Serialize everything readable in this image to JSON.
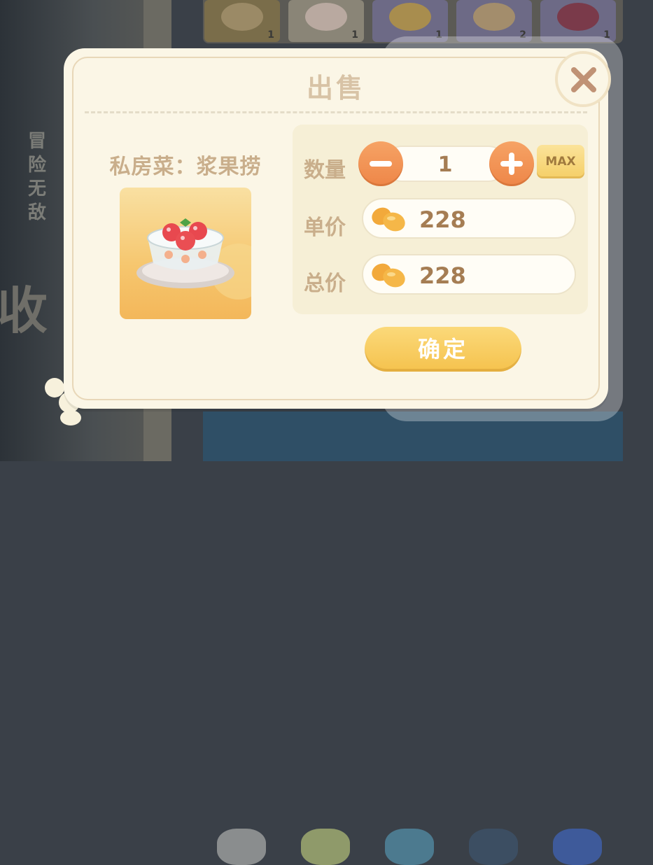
{
  "background": {
    "side_text": "冒险无敌",
    "big_glyph": "收",
    "top_counts": [
      "1",
      "1",
      "1",
      "2",
      "1"
    ]
  },
  "dialog": {
    "title": "出售",
    "item_name": "私房菜：浆果捞",
    "item_icon": "berry-dessert-bowl",
    "quantity_label": "数量",
    "quantity_value": "1",
    "minus_icon": "minus-icon",
    "plus_icon": "plus-icon",
    "max_label": "MAX",
    "unit_price_label": "单价",
    "unit_price_value": "228",
    "total_price_label": "总价",
    "total_price_value": "228",
    "currency_icon": "bean-coin-icon",
    "confirm_label": "确定",
    "close_icon": "close-icon"
  },
  "colors": {
    "panel_bg": "#fbf6e6",
    "label_text": "#c9ae8b",
    "accent_orange": "#ee8648",
    "confirm_yellow": "#f5c24d"
  }
}
